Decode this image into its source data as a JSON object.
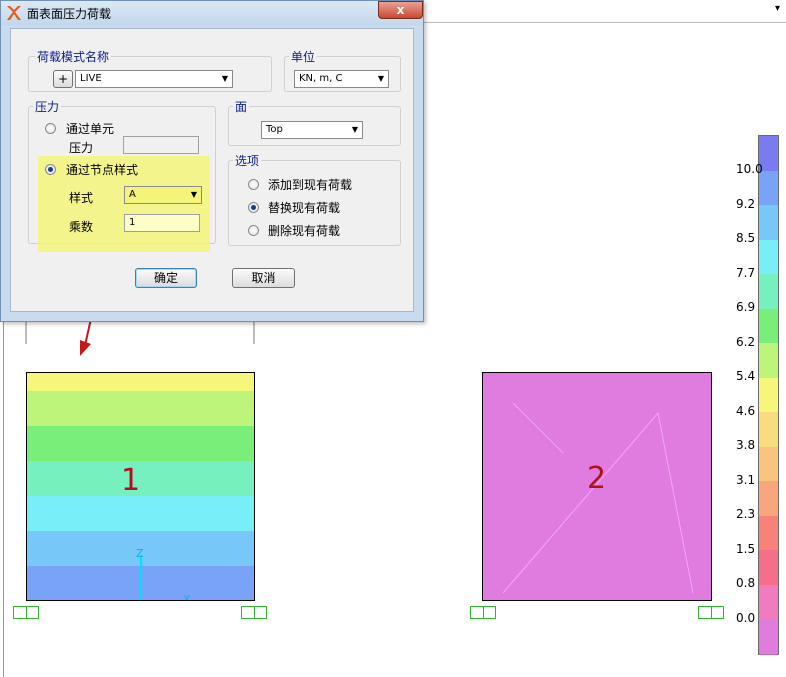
{
  "dialog": {
    "title": "面表面压力荷载",
    "close_label": "x",
    "load_pattern": {
      "label": "荷载模式名称",
      "add_label": "+",
      "value": "LIVE"
    },
    "units": {
      "label": "单位",
      "value": "KN, m, C"
    },
    "pressure": {
      "label": "压力",
      "by_element": {
        "label": "通过单元",
        "selected": false,
        "pressure_label": "压力",
        "pressure_value": ""
      },
      "by_joint_pattern": {
        "label": "通过节点样式",
        "selected": true,
        "pattern_label": "样式",
        "pattern_value": "A",
        "multiplier_label": "乘数",
        "multiplier_value": "1"
      }
    },
    "face": {
      "label": "面",
      "value": "Top"
    },
    "options": {
      "label": "选项",
      "items": [
        {
          "label": "添加到现有荷载",
          "selected": false
        },
        {
          "label": "替换现有荷载",
          "selected": true
        },
        {
          "label": "删除现有荷载",
          "selected": false
        }
      ]
    },
    "ok_label": "确定",
    "cancel_label": "取消",
    "highlight_color": "#f4f47a"
  },
  "viewport": {
    "topbar_dropdown": "▾",
    "area_1_label": "1",
    "area_2_label": "2",
    "area_2_color": "#e07be0",
    "axis_z": "Z",
    "axis_x": "X",
    "arrow_color": "#c41a1a"
  },
  "legend": {
    "ticks": [
      "10.0",
      "9.2",
      "8.5",
      "7.7",
      "6.9",
      "6.2",
      "5.4",
      "4.6",
      "3.8",
      "3.1",
      "2.3",
      "1.5",
      "0.8",
      "0.0"
    ],
    "colors": [
      "#7b7bf0",
      "#79a3f6",
      "#77c8f8",
      "#77eef8",
      "#77f0c0",
      "#79ef7a",
      "#bcf57a",
      "#f6f67a",
      "#f8dc7e",
      "#f8c47e",
      "#f8a67e",
      "#f6827a",
      "#f56f8a",
      "#f07bbe",
      "#e07be0"
    ]
  }
}
